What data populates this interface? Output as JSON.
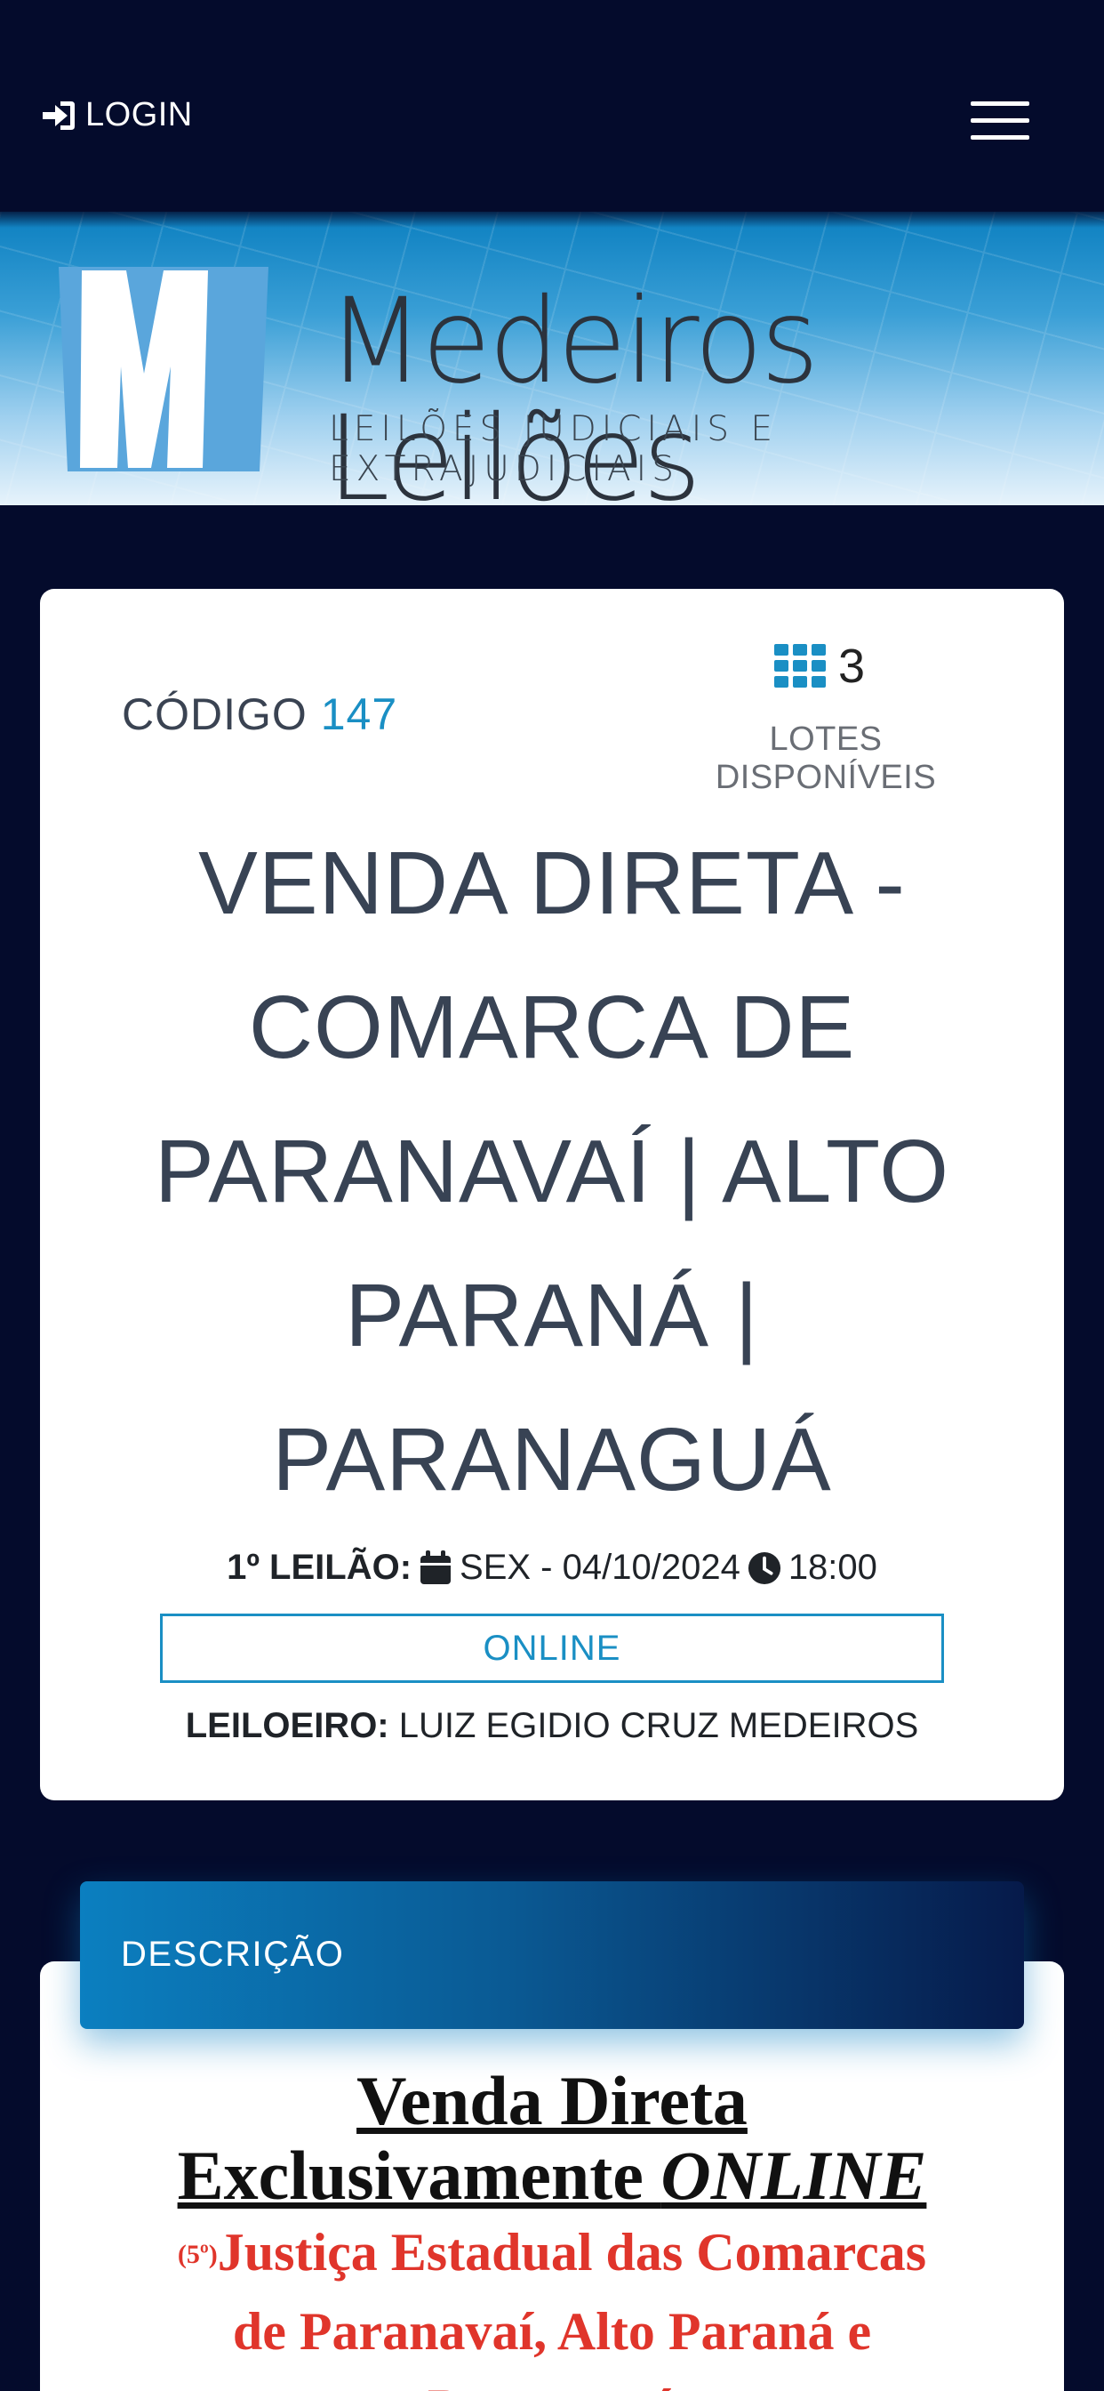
{
  "nav": {
    "login_label": "LOGIN"
  },
  "banner": {
    "brand_name": "Medeiros Leilões",
    "brand_tagline": "LEILÕES JUDICIAIS E EXTRAJUDICIAIS"
  },
  "auction": {
    "code_label": "CÓDIGO",
    "code_value": "147",
    "lots_count": "3",
    "lots_label": "LOTES DISPONÍVEIS",
    "title_lines": [
      "VENDA DIRETA -",
      "COMARCA DE",
      "PARANAVAÍ | ALTO",
      "PARANÁ |",
      "PARANAGUÁ"
    ],
    "first_auction_label": "1º LEILÃO:",
    "first_auction_date": "SEX - 04/10/2024",
    "first_auction_time": "18:00",
    "mode": "ONLINE",
    "auctioneer_label": "LEILOEIRO:",
    "auctioneer_name": "LUIZ EGIDIO CRUZ MEDEIROS"
  },
  "description": {
    "tab_label": "DESCRIÇÃO",
    "line1": "Venda Direta",
    "line2_prefix": "Exclusivamente ",
    "line2_italic": "ONLINE",
    "line3_sup": "(5º)",
    "line3_text": "Justiça Estadual das Comarcas",
    "line4": "de Paranavaí, Alto Paraná e",
    "line5": "Paranaguá"
  },
  "colors": {
    "background": "#040b2c",
    "accent": "#1a8fc4",
    "title_text": "#384354",
    "red_text": "#e0352b"
  },
  "icons": [
    "sign-in-icon",
    "hamburger-menu-icon",
    "grid-icon",
    "calendar-icon",
    "clock-icon"
  ]
}
